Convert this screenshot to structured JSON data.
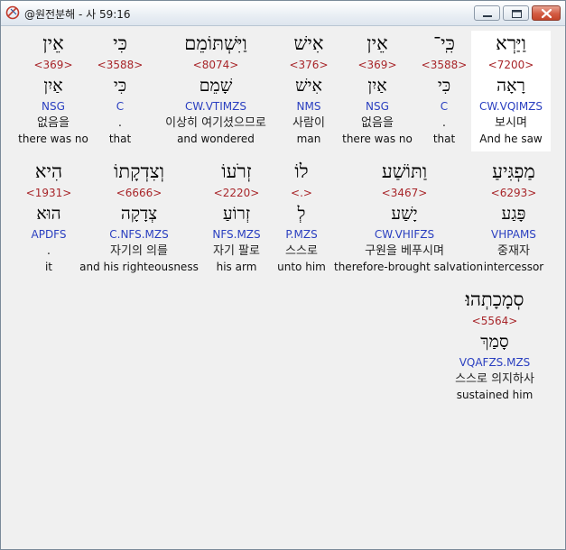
{
  "window": {
    "title": "@원전분해 - 사 59:16",
    "icon": "app-logo-icon",
    "buttons": [
      "minimize-icon",
      "maximize-icon",
      "close-icon"
    ]
  },
  "colors": {
    "strong": "#a8262a",
    "morph": "#2a3fc0",
    "highlight": "#ffffff"
  },
  "words": [
    {
      "surface": "וַיַּרְא",
      "strong": "<7200>",
      "lemma": "רָאָה",
      "morph": "CW.VQIMZS",
      "korean": "보시며",
      "english": "And he saw"
    },
    {
      "surface": "כִּֽי־",
      "strong": "<3588>",
      "lemma": "כִּי",
      "morph": "C",
      "korean": ".",
      "english": "that"
    },
    {
      "surface": "אֵין",
      "strong": "<369>",
      "lemma": "אַיִן",
      "morph": "NSG",
      "korean": "없음을",
      "english": "there was no"
    },
    {
      "surface": "אִישׁ",
      "strong": "<376>",
      "lemma": "אִישׁ",
      "morph": "NMS",
      "korean": "사람이",
      "english": "man"
    },
    {
      "surface": "וַיִּשְׁתּוֹמֵם",
      "strong": "<8074>",
      "lemma": "שָׁמֵם",
      "morph": "CW.VTIMZS",
      "korean": "이상히 여기셨으므로",
      "english": "and wondered"
    },
    {
      "surface": "כִּי",
      "strong": "<3588>",
      "lemma": "כִּי",
      "morph": "C",
      "korean": ".",
      "english": "that"
    },
    {
      "surface": "אֵין",
      "strong": "<369>",
      "lemma": "אַיִן",
      "morph": "NSG",
      "korean": "없음을",
      "english": "there was no"
    },
    {
      "surface": "מַפְגִּיעַ",
      "strong": "<6293>",
      "lemma": "פָּגַע",
      "morph": "VHPAMS",
      "korean": "중재자",
      "english": "intercessor"
    },
    {
      "surface": "וַתּוֹשַׁע",
      "strong": "<3467>",
      "lemma": "יָשַׁע",
      "morph": "CW.VHIFZS",
      "korean": "구원을 베푸시며",
      "english": "therefore-brought salvation"
    },
    {
      "surface": "לוֹ",
      "strong": "<.>",
      "lemma": "לְ",
      "morph": "P.MZS",
      "korean": "스스로",
      "english": "unto him"
    },
    {
      "surface": "זְרֹעוֹ",
      "strong": "<2220>",
      "lemma": "זְרוֹעַ",
      "morph": "NFS.MZS",
      "korean": "자기 팔로",
      "english": "his arm"
    },
    {
      "surface": "וְצִדְקָתוֹ",
      "strong": "<6666>",
      "lemma": "צְדָקָה",
      "morph": "C.NFS.MZS",
      "korean": "자기의 의를",
      "english": "and his righteousness"
    },
    {
      "surface": "הִיא",
      "strong": "<1931>",
      "lemma": "הוּא",
      "morph": "APDFS",
      "korean": ".",
      "english": "it"
    },
    {
      "surface": "סְמָכָתְהוּ׃",
      "strong": "<5564>",
      "lemma": "סָמַךְ",
      "morph": "VQAFZS.MZS",
      "korean": "스스로 의지하사",
      "english": "sustained him"
    }
  ]
}
